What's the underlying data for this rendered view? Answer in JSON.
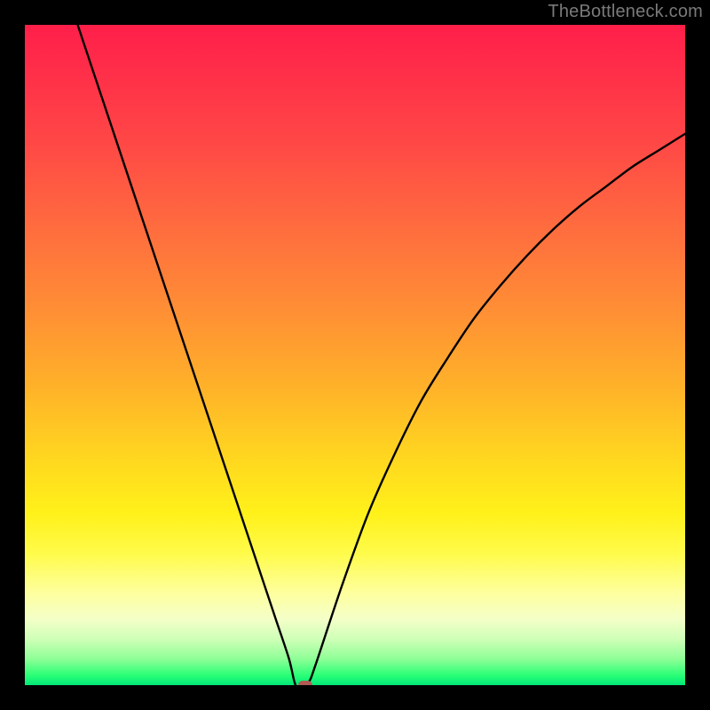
{
  "watermark": "TheBottleneck.com",
  "chart_data": {
    "type": "line",
    "title": "",
    "xlabel": "",
    "ylabel": "",
    "xlim": [
      0,
      100
    ],
    "ylim": [
      0,
      100
    ],
    "grid": false,
    "legend": false,
    "vertex_x": 41,
    "marker": {
      "x": 42.5,
      "y": 0,
      "color": "#b05a54"
    },
    "series": [
      {
        "name": "bottleneck-curve",
        "color": "#000000",
        "x": [
          8,
          12,
          16,
          20,
          24,
          28,
          32,
          36,
          38,
          40,
          41,
          42,
          43,
          44,
          48,
          52,
          56,
          60,
          64,
          68,
          72,
          76,
          80,
          84,
          88,
          92,
          96,
          100
        ],
        "y": [
          100,
          88,
          76,
          64,
          52,
          40,
          28,
          16,
          10,
          4,
          0,
          0,
          0.5,
          3,
          15,
          26,
          35,
          43,
          49.5,
          55.5,
          60.5,
          65,
          69,
          72.5,
          75.5,
          78.5,
          81,
          83.5
        ]
      }
    ],
    "gradient_stops": [
      {
        "pct": 0,
        "color": "#ff1f4a"
      },
      {
        "pct": 7,
        "color": "#ff2e49"
      },
      {
        "pct": 18,
        "color": "#ff4846"
      },
      {
        "pct": 30,
        "color": "#ff6a3f"
      },
      {
        "pct": 42,
        "color": "#ff8b36"
      },
      {
        "pct": 55,
        "color": "#ffb229"
      },
      {
        "pct": 66,
        "color": "#ffd81f"
      },
      {
        "pct": 74,
        "color": "#fff11a"
      },
      {
        "pct": 80,
        "color": "#fffb4a"
      },
      {
        "pct": 86,
        "color": "#feff9e"
      },
      {
        "pct": 90,
        "color": "#f4ffc8"
      },
      {
        "pct": 93,
        "color": "#cfffb8"
      },
      {
        "pct": 96,
        "color": "#8fff96"
      },
      {
        "pct": 98.5,
        "color": "#2bff77"
      },
      {
        "pct": 100,
        "color": "#00e877"
      }
    ]
  }
}
